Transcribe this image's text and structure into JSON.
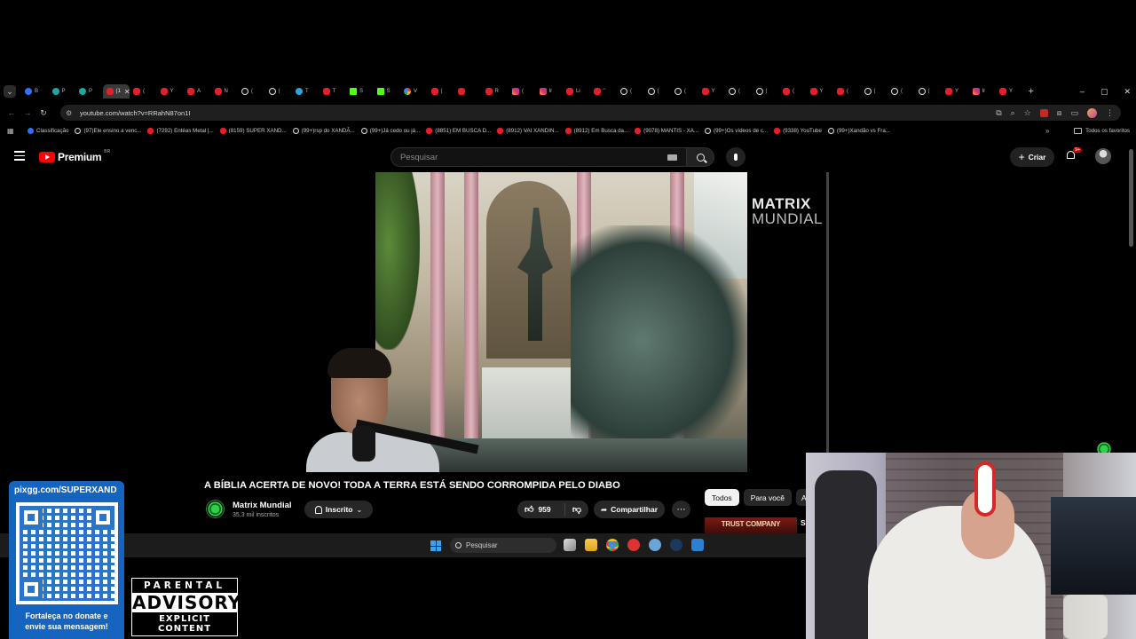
{
  "browser": {
    "tabs": [
      {
        "icon": "tab-menu",
        "label": "B"
      },
      {
        "icon": "gd",
        "label": "B"
      },
      {
        "icon": "pl",
        "label": "P"
      },
      {
        "icon": "pl",
        "label": "P"
      },
      {
        "icon": "yt",
        "label": "(1",
        "active": true
      },
      {
        "icon": "yt",
        "label": "("
      },
      {
        "icon": "yt",
        "label": "Y"
      },
      {
        "icon": "yt",
        "label": "A"
      },
      {
        "icon": "yt",
        "label": "N"
      },
      {
        "icon": "tt",
        "label": "("
      },
      {
        "icon": "tt",
        "label": "("
      },
      {
        "icon": "tg",
        "label": "T"
      },
      {
        "icon": "yt",
        "label": "T"
      },
      {
        "icon": "kk",
        "label": "S"
      },
      {
        "icon": "kk",
        "label": "S"
      },
      {
        "icon": "gg",
        "label": "V"
      },
      {
        "icon": "yt",
        "label": "("
      },
      {
        "icon": "yt",
        "label": ""
      },
      {
        "icon": "yt",
        "label": "R"
      },
      {
        "icon": "ig",
        "label": "("
      },
      {
        "icon": "ig",
        "label": "Ir"
      },
      {
        "icon": "yt",
        "label": "Li"
      },
      {
        "icon": "yt",
        "label": "\""
      },
      {
        "icon": "tt",
        "label": "("
      },
      {
        "icon": "tt",
        "label": "("
      },
      {
        "icon": "tt",
        "label": "("
      },
      {
        "icon": "yt",
        "label": "Y"
      },
      {
        "icon": "tt",
        "label": "("
      },
      {
        "icon": "tt",
        "label": "("
      },
      {
        "icon": "yt",
        "label": "("
      },
      {
        "icon": "yt",
        "label": "Y"
      },
      {
        "icon": "yt",
        "label": "("
      },
      {
        "icon": "tt",
        "label": "("
      },
      {
        "icon": "tt",
        "label": "("
      },
      {
        "icon": "tt",
        "label": "("
      },
      {
        "icon": "yt",
        "label": "Y"
      },
      {
        "icon": "ig",
        "label": "Ir"
      },
      {
        "icon": "yt",
        "label": "Y"
      }
    ],
    "new_tab": "+",
    "window_controls": {
      "minimize": "–",
      "maximize": "▢",
      "close": "✕"
    },
    "url": "youtube.com/watch?v=RRahN87on1I",
    "bookmarks": [
      {
        "icon": "gd",
        "label": "Classificação"
      },
      {
        "icon": "tt",
        "label": "(97)Ele ensino a venc..."
      },
      {
        "icon": "yt",
        "label": "(7292) Entéas Metal |..."
      },
      {
        "icon": "yt",
        "label": "(8159) SUPER XAND..."
      },
      {
        "icon": "tt",
        "label": "(99+)rsp do XANDÃ..."
      },
      {
        "icon": "tt",
        "label": "(99+)Já cedo ou já..."
      },
      {
        "icon": "yt",
        "label": "(8851) EM BUSCA D..."
      },
      {
        "icon": "yt",
        "label": "(8912) VAI XANDIN..."
      },
      {
        "icon": "yt",
        "label": "(8912) Em Busca da..."
      },
      {
        "icon": "yt",
        "label": "(9078) MANTIS - XA..."
      },
      {
        "icon": "tt",
        "label": "(99+)Os vídeos de c..."
      },
      {
        "icon": "yt",
        "label": "(9338) YouTube"
      },
      {
        "icon": "tt",
        "label": "(99+)Xandão vs Fra..."
      }
    ],
    "bookmarks_more": "»",
    "all_bookmarks": "Todos os favoritos"
  },
  "youtube": {
    "logo_text": "Premium",
    "country": "BR",
    "search_placeholder": "Pesquisar",
    "create_label": "Criar",
    "notifications_badge": "9+",
    "watermark_line1": "MATRIX",
    "watermark_line2": "MUNDIAL",
    "video_title": "A BÍBLIA ACERTA DE NOVO! TODA A TERRA ESTÁ SENDO CORROMPIDA PELO DIABO",
    "channel_name": "Matrix Mundial",
    "channel_subs": "35,3 mil inscritos",
    "subscribed_label": "Inscrito",
    "like_count": "959",
    "share_label": "Compartilhar",
    "chips": [
      "Todos",
      "Para você",
      "A"
    ],
    "rec_thumb_text": "TRUST COMPANY",
    "rec_title_cut": "S"
  },
  "taskbar": {
    "search_label": "Pesquisar"
  },
  "overlay": {
    "pix_url": "pixgg.com/SUPERXAND",
    "pix_message_line1": "Fortaleça no donate e",
    "pix_message_line2": "envie sua mensagem!",
    "advisory_top": "PARENTAL",
    "advisory_mid": "ADVISORY",
    "advisory_bottom": "EXPLICIT CONTENT"
  },
  "colors": {
    "youtube_red": "#ff0000",
    "pix_blue": "#1565c0",
    "badge_red": "#cc0000"
  }
}
